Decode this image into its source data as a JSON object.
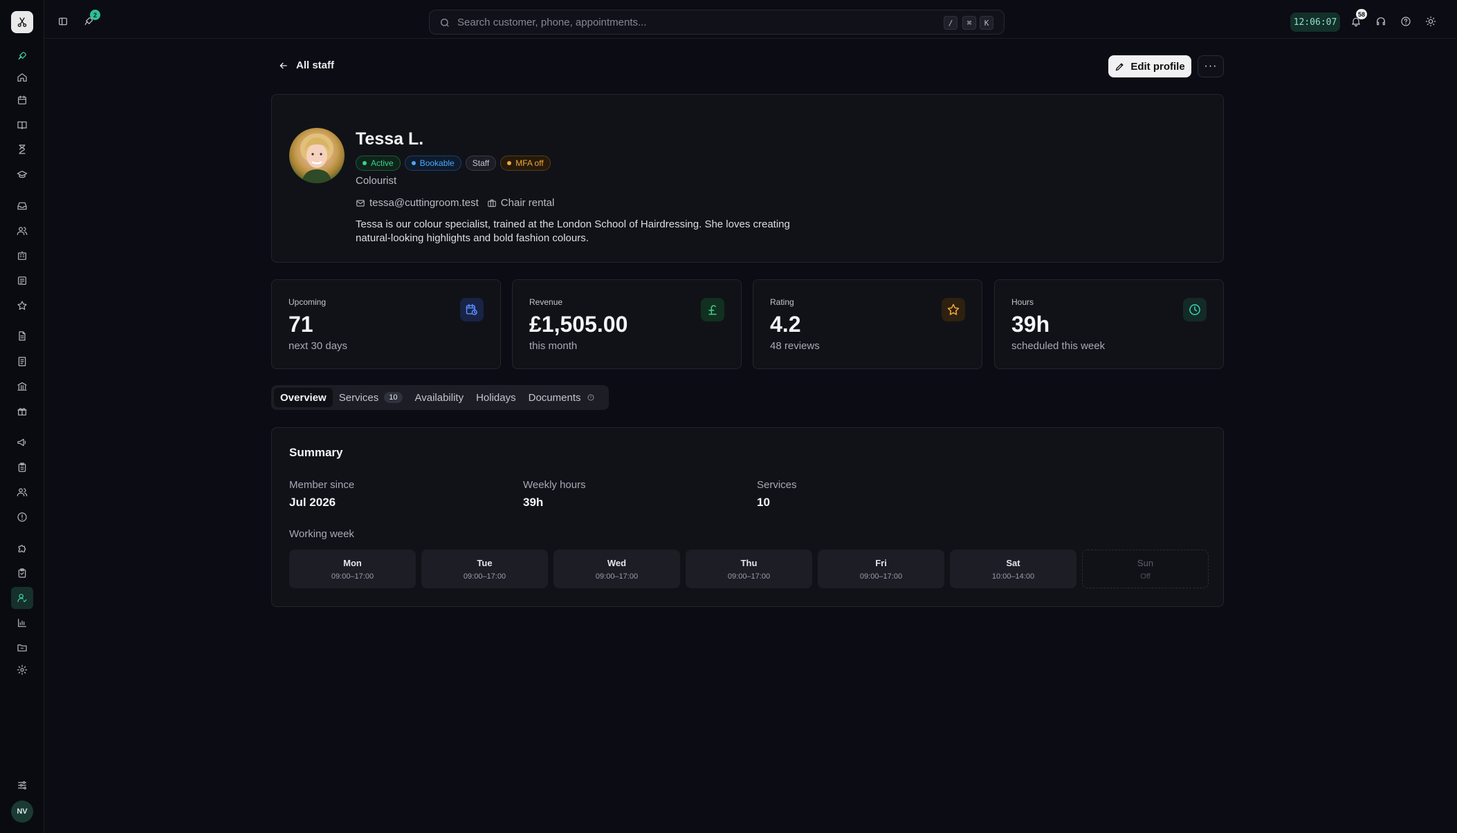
{
  "topbar": {
    "notification_count": "2",
    "search_placeholder": "Search customer, phone, appointments...",
    "kbd_keys": [
      "/",
      "⌘",
      "K"
    ],
    "clock": "12:06:07",
    "bell_count": "58"
  },
  "sidebar": {
    "user_initials": "NV",
    "active_item": "staff"
  },
  "page": {
    "back_label": "All staff",
    "edit_label": "Edit profile",
    "more_label": "···"
  },
  "profile": {
    "name": "Tessa L.",
    "chips": [
      {
        "label": "Active",
        "color": "#3fd18c"
      },
      {
        "label": "Bookable",
        "color": "#4aa8ff"
      },
      {
        "label": "Staff",
        "color": "#c3c5ce"
      },
      {
        "label": "MFA off",
        "color": "#f2a73b"
      }
    ],
    "role": "Colourist",
    "email": "tessa@cuttingroom.test",
    "employment": "Chair rental",
    "bio": "Tessa is our colour specialist, trained at the London School of Hairdressing. She loves creating natural-looking highlights and bold fashion colours."
  },
  "stats": [
    {
      "label": "Upcoming",
      "value": "71",
      "sub": "next 30 days",
      "icon": "calendar-clock-icon",
      "color": "#5a8cff"
    },
    {
      "label": "Revenue",
      "value": "£1,505.00",
      "sub": "this month",
      "icon": "pound-icon",
      "color": "#3fd18c"
    },
    {
      "label": "Rating",
      "value": "4.2",
      "sub": "48 reviews",
      "icon": "star-icon",
      "color": "#f2a73b"
    },
    {
      "label": "Hours",
      "value": "39h",
      "sub": "scheduled this week",
      "icon": "clock-icon",
      "color": "#3ed3b0"
    }
  ],
  "tabs": [
    {
      "label": "Overview"
    },
    {
      "label": "Services",
      "count": "10"
    },
    {
      "label": "Availability"
    },
    {
      "label": "Holidays"
    },
    {
      "label": "Documents"
    }
  ],
  "summary": {
    "title": "Summary",
    "member_since_label": "Member since",
    "member_since": "Jul 2026",
    "weekly_hours_label": "Weekly hours",
    "weekly_hours": "39h",
    "services_label": "Services",
    "services": "10",
    "working_week_label": "Working week",
    "days": [
      {
        "name": "Mon",
        "hours": "09:00–17:00"
      },
      {
        "name": "Tue",
        "hours": "09:00–17:00"
      },
      {
        "name": "Wed",
        "hours": "09:00–17:00"
      },
      {
        "name": "Thu",
        "hours": "09:00–17:00"
      },
      {
        "name": "Fri",
        "hours": "09:00–17:00"
      },
      {
        "name": "Sat",
        "hours": "10:00–14:00"
      },
      {
        "name": "Sun",
        "hours": "Off"
      }
    ]
  }
}
